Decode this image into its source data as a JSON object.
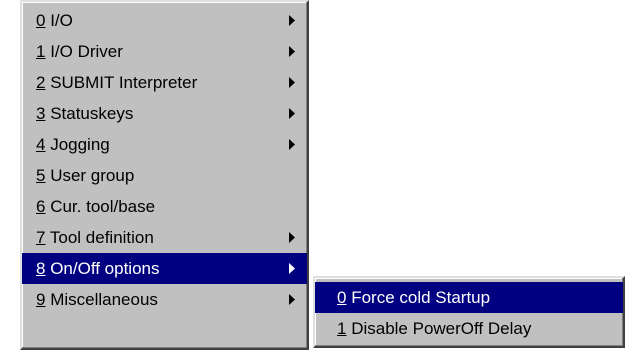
{
  "main_menu": {
    "items": [
      {
        "accel": "0",
        "label": " I/O",
        "has_submenu": true
      },
      {
        "accel": "1",
        "label": " I/O Driver",
        "has_submenu": true
      },
      {
        "accel": "2",
        "label": " SUBMIT Interpreter",
        "has_submenu": true
      },
      {
        "accel": "3",
        "label": " Statuskeys",
        "has_submenu": true
      },
      {
        "accel": "4",
        "label": " Jogging",
        "has_submenu": true
      },
      {
        "accel": "5",
        "label": " User group",
        "has_submenu": false
      },
      {
        "accel": "6",
        "label": " Cur. tool/base",
        "has_submenu": false
      },
      {
        "accel": "7",
        "label": " Tool definition",
        "has_submenu": true
      },
      {
        "accel": "8",
        "label": " On/Off options",
        "has_submenu": true,
        "highlighted": true
      },
      {
        "accel": "9",
        "label": " Miscellaneous",
        "has_submenu": true
      }
    ]
  },
  "sub_menu": {
    "items": [
      {
        "accel": "0",
        "label": " Force cold Startup",
        "highlighted": true
      },
      {
        "accel": "1",
        "label": " Disable PowerOff Delay"
      }
    ]
  },
  "colors": {
    "menu_bg": "#c0c0c0",
    "highlight_bg": "#000080",
    "highlight_text": "#ffffff"
  },
  "icons": {
    "submenu_arrow": "submenu-arrow-icon"
  }
}
